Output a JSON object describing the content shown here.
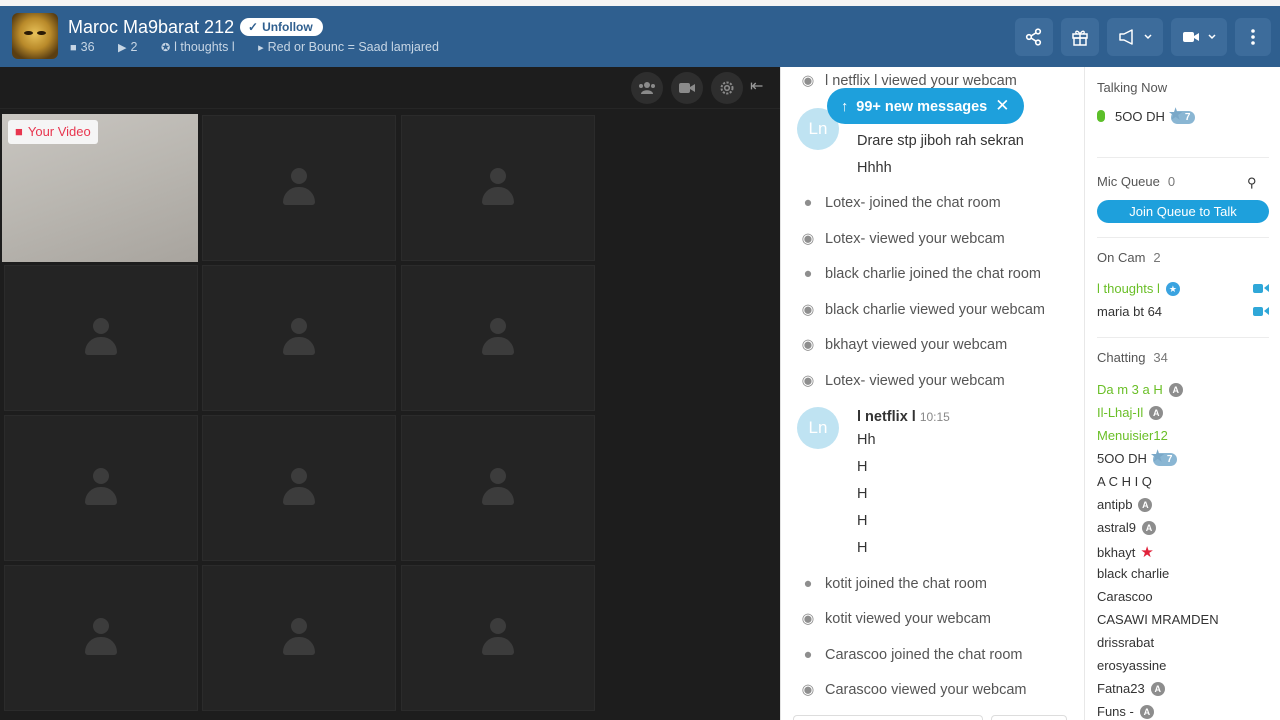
{
  "header": {
    "room_title": "Maroc Ma9barat 212",
    "follow_button": "Unfollow",
    "viewers_count": "36",
    "cams_count": "2",
    "broadcaster": "l thoughts l",
    "topic": "Red or Bounc = Saad lamjared",
    "icons": [
      "share-icon",
      "gift-icon",
      "megaphone-icon",
      "video-camera-icon",
      "more-vertical-icon"
    ]
  },
  "video": {
    "your_video_label": "Your Video",
    "toolbar_icons": [
      "people-icon",
      "camera-icon",
      "settings-icon",
      "collapse-icon"
    ]
  },
  "chat": {
    "new_messages_banner": "99+ new messages",
    "events_top": [
      {
        "icon": "eye-icon",
        "text": "l netflix l viewed your webcam"
      }
    ],
    "message1": {
      "avatar": "Ln",
      "lines": [
        "Drare stp jiboh rah sekran",
        "Hhhh"
      ]
    },
    "events_mid": [
      {
        "icon": "user-icon",
        "text": "Lotex- joined the chat room"
      },
      {
        "icon": "eye-icon",
        "text": "Lotex- viewed your webcam"
      },
      {
        "icon": "user-icon",
        "text": "black charlie joined the chat room"
      },
      {
        "icon": "eye-icon",
        "text": "black charlie viewed your webcam"
      },
      {
        "icon": "eye-icon",
        "text": "bkhayt viewed your webcam"
      },
      {
        "icon": "eye-icon",
        "text": "Lotex- viewed your webcam"
      }
    ],
    "message2": {
      "avatar": "Ln",
      "user": "l netflix l",
      "time": "10:15",
      "lines": [
        "Hh",
        "H",
        "H",
        "H",
        "H"
      ]
    },
    "events_bottom": [
      {
        "icon": "user-icon",
        "text": "kotit joined the chat room"
      },
      {
        "icon": "eye-icon",
        "text": "kotit viewed your webcam"
      },
      {
        "icon": "user-icon",
        "text": "Carascoo joined the chat room"
      },
      {
        "icon": "eye-icon",
        "text": "Carascoo viewed your webcam"
      }
    ]
  },
  "sidebar": {
    "talking_now": {
      "title": "Talking Now",
      "user": "5OO DH",
      "level": "7"
    },
    "mic_queue": {
      "title": "Mic Queue",
      "count": "0",
      "join_button": "Join Queue to Talk"
    },
    "on_cam": {
      "title": "On Cam",
      "count": "2",
      "users": [
        {
          "name": "l thoughts l",
          "color": "#6abf27",
          "badge": "blue-star"
        },
        {
          "name": "maria bt 64",
          "color": "#333333",
          "badge": ""
        }
      ]
    },
    "chatting": {
      "title": "Chatting",
      "count": "34",
      "users": [
        {
          "name": "Da m 3 a H",
          "green": true,
          "badge": "A"
        },
        {
          "name": "Il-Lhaj-Il",
          "green": true,
          "badge": "A"
        },
        {
          "name": "Menuisier12",
          "green": true,
          "badge": ""
        },
        {
          "name": "5OO DH",
          "green": false,
          "badge": "level",
          "level": "7"
        },
        {
          "name": "A C H I Q",
          "green": false,
          "badge": ""
        },
        {
          "name": "antipb",
          "green": false,
          "badge": "A"
        },
        {
          "name": "astral9",
          "green": false,
          "badge": "A"
        },
        {
          "name": "bkhayt",
          "green": false,
          "badge": "red-star"
        },
        {
          "name": "black charlie",
          "green": false,
          "badge": ""
        },
        {
          "name": "Carascoo",
          "green": false,
          "badge": ""
        },
        {
          "name": "CASAWI MRAMDEN",
          "green": false,
          "badge": ""
        },
        {
          "name": "drissrabat",
          "green": false,
          "badge": ""
        },
        {
          "name": "erosyassine",
          "green": false,
          "badge": ""
        },
        {
          "name": "Fatna23",
          "green": false,
          "badge": "A"
        },
        {
          "name": "Funs -",
          "green": false,
          "badge": "A"
        }
      ]
    }
  },
  "colors": {
    "header_bg": "#2f5f8f",
    "accent_blue": "#1ea0dc",
    "online_green": "#6abf27",
    "video_bg": "#1d1d1d"
  }
}
